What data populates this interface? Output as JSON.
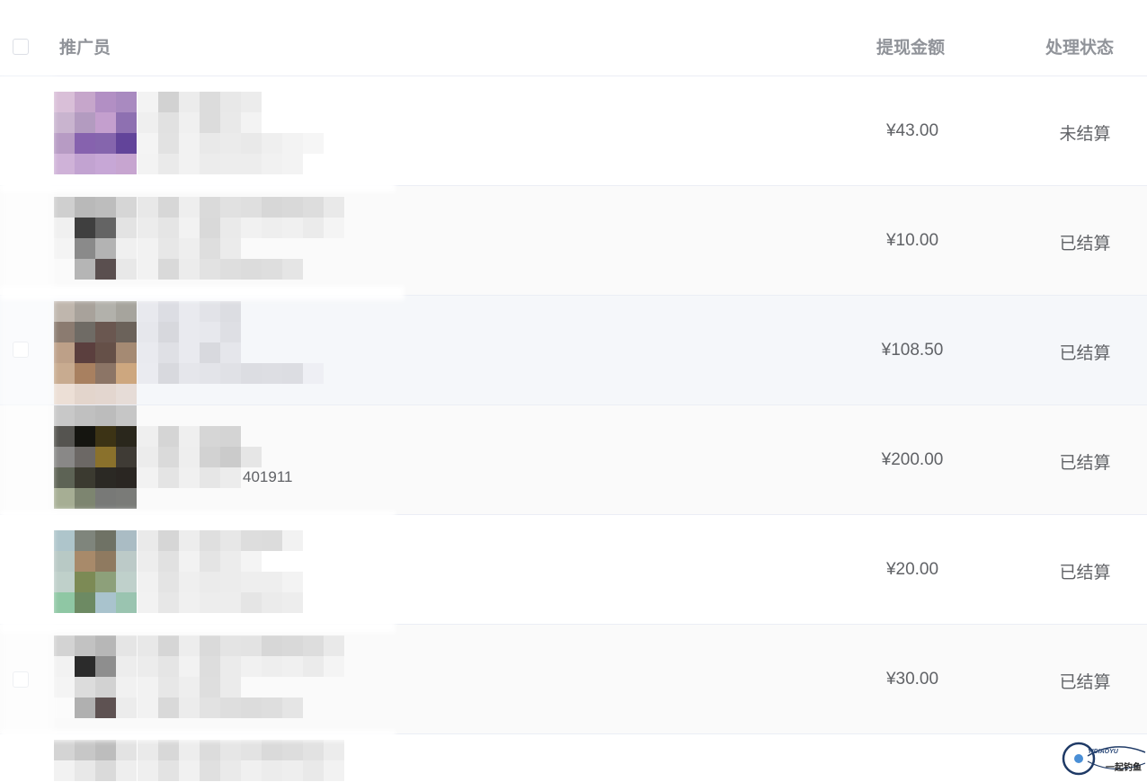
{
  "table": {
    "columns": {
      "promoter": "推广员",
      "amount": "提现金额",
      "status": "处理状态"
    },
    "rows": [
      {
        "amount": "¥43.00",
        "status": "未结算"
      },
      {
        "amount": "¥10.00",
        "status": "已结算"
      },
      {
        "amount": "¥108.50",
        "status": "已结算"
      },
      {
        "amount": "¥200.00",
        "status": "已结算",
        "name_fragment": "401911"
      },
      {
        "amount": "¥20.00",
        "status": "已结算"
      },
      {
        "amount": "¥30.00",
        "status": "已结算"
      }
    ]
  },
  "watermark": {
    "brand_latin": "YIDIAOYU",
    "brand_cn": "一起钓鱼"
  },
  "colors": {
    "border": "#ebeef5",
    "header_text": "#909399",
    "cell_text": "#606266",
    "stripe": "#fafafa",
    "hover": "#f5f7fa"
  }
}
